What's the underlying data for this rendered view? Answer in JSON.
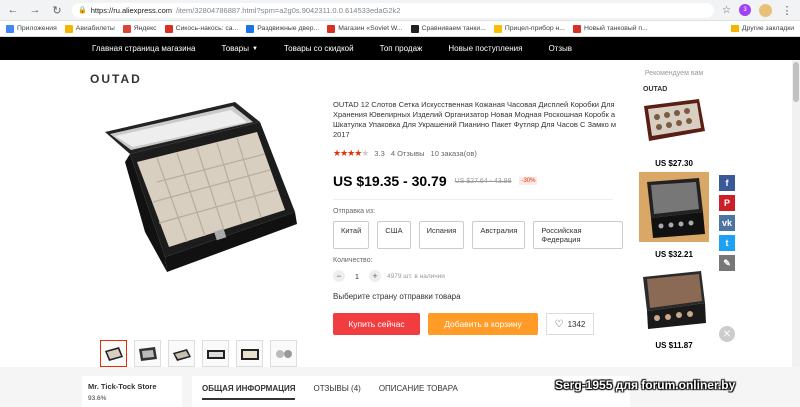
{
  "browser": {
    "url_host": "https://ru.aliexpress.com",
    "url_path": "/item/32804786887.html?spm=a2g0s.9042311.0.0.614533edaG2k2",
    "ext_badge": "3"
  },
  "bookmarks": {
    "items": [
      {
        "label": "Приложения",
        "color": "#4285f4"
      },
      {
        "label": "Авиабилеты",
        "color": "#f4b400"
      },
      {
        "label": "Яндекс",
        "color": "#db4437"
      },
      {
        "label": "Сикось-накось: ca...",
        "color": "#d93025"
      },
      {
        "label": "Раздвижные двер...",
        "color": "#1a73e8"
      },
      {
        "label": "Магазин «Soviet W...",
        "color": "#d93025"
      },
      {
        "label": "Сравниваем танки...",
        "color": "#202124"
      },
      {
        "label": "Прицел-прибор н...",
        "color": "#fbbc04"
      },
      {
        "label": "Новый танковый п...",
        "color": "#d93025"
      }
    ],
    "other": "Другие закладки"
  },
  "catnav": {
    "items": [
      "Главная страница магазина",
      "Товары",
      "Товары со скидкой",
      "Топ продаж",
      "Новые поступления",
      "Отзыв"
    ]
  },
  "product": {
    "brand": "OUTAD",
    "title": "OUTAD 12 Слотов Сетка Искусственная Кожаная Часовая Дисплей Коробки Для Хранения Ювелирных Изделий Организатор Новая Модная Роскошная Коробк а Шкатулка Упаковка Для Украшений Пианино Пакет Футляр Для Часов С Замко м 2017",
    "rating_value": 3.3,
    "rating": "3.3",
    "reviews": "4 Отзывы",
    "orders": "10 заказа(ов)",
    "price": "US $19.35 - 30.79",
    "old_price": "US $27.64 - 43.99",
    "discount": "-30%",
    "ships_label": "Отправка из:",
    "ships_from": [
      "Китай",
      "США",
      "Испания",
      "Австралия",
      "Российская Федерация"
    ],
    "qty_label": "Количество:",
    "qty": "1",
    "available": "4979 шт. в наличии",
    "choose_country": "Выберите страну отправки товара",
    "buy_now": "Купить сейчас",
    "add_to_cart": "Добавить в корзину",
    "wishlist_count": "1342"
  },
  "recommended": {
    "title": "Рекомендуем вам",
    "items": [
      {
        "price": "US $27.30",
        "brand": "OUTAD"
      },
      {
        "price": "US $32.21"
      },
      {
        "price": "US $11.87"
      }
    ]
  },
  "social": {
    "colors": [
      "#3b5998",
      "#cb2027",
      "#4c75a3",
      "#1da1f2",
      "#777777"
    ]
  },
  "store": {
    "name": "Mr. Tick-Tock Store",
    "rating": "93.6%"
  },
  "tabs": [
    "ОБЩАЯ ИНФОРМАЦИЯ",
    "ОТЗЫВЫ (4)",
    "ОПИСАНИЕ ТОВАРА"
  ],
  "watermark": "Serg-1955 для forum.onliner.by"
}
